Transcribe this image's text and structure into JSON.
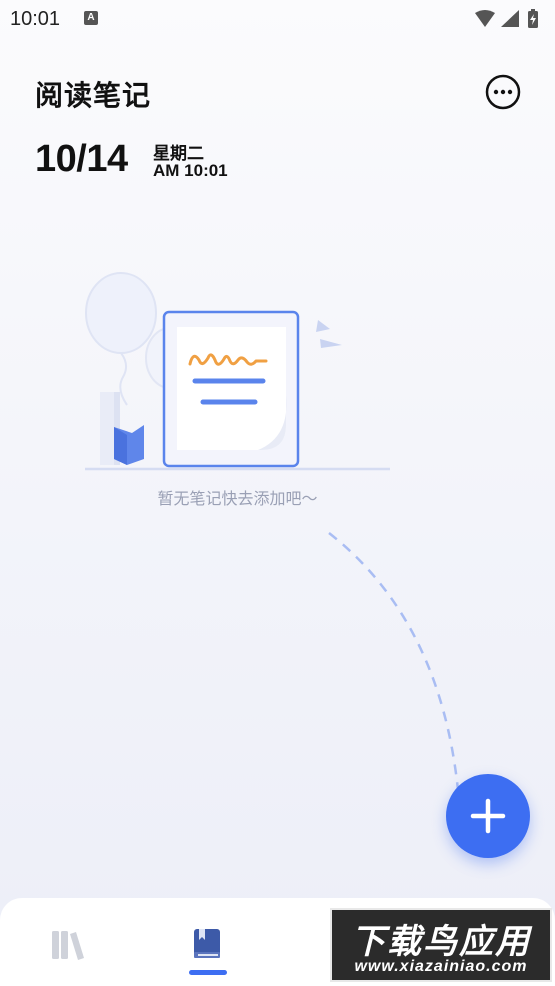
{
  "status_bar": {
    "time": "10:01",
    "notification_badge": "A",
    "icons": [
      "wifi-icon",
      "signal-icon",
      "battery-icon"
    ]
  },
  "header": {
    "title": "阅读笔记",
    "more_icon": "more-horizontal-icon"
  },
  "date": {
    "day": "10/14",
    "weekday": "星期二",
    "time": "AM 10:01"
  },
  "empty_state": {
    "message": "暂无笔记快去添加吧～"
  },
  "fab": {
    "icon": "plus-icon"
  },
  "bottom_nav": {
    "items": [
      {
        "name": "bookshelf",
        "icon": "books-icon",
        "active": false
      },
      {
        "name": "notes",
        "icon": "book-icon",
        "active": true
      }
    ]
  },
  "watermark": {
    "title": "下载鸟应用",
    "url": "www.xiazainiao.com"
  },
  "colors": {
    "accent": "#3d6ef2",
    "inactive_icon": "#cfd2da",
    "hint_text": "#9aa0b5",
    "illustration_orange": "#f0a043"
  }
}
